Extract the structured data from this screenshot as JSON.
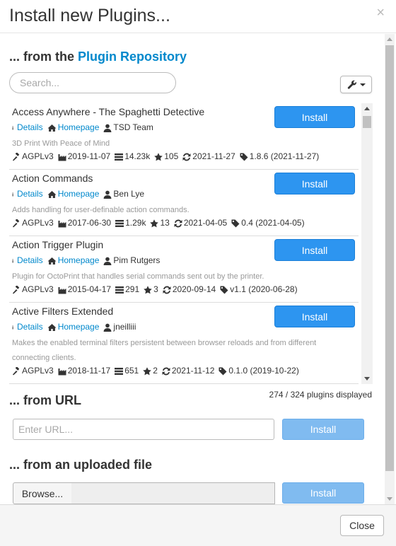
{
  "header": {
    "title": "Install new Plugins...",
    "close_glyph": "×"
  },
  "repository": {
    "prefix": "... from the ",
    "link": "Plugin Repository",
    "search_placeholder": "Search...",
    "tools_icon": "wrench-icon",
    "count_text": "274 / 324 plugins displayed"
  },
  "plugins": [
    {
      "name": "Access Anywhere - The Spaghetti Detective",
      "details_label": "Details",
      "homepage_label": "Homepage",
      "author": "TSD Team",
      "description": "3D Print With Peace of Mind",
      "license": "AGPLv3",
      "created": "2019-11-07",
      "downloads": "14.23k",
      "stars": "105",
      "updated": "2021-11-27",
      "release": "1.8.6 (2021-11-27)",
      "install_label": "Install"
    },
    {
      "name": "Action Commands",
      "details_label": "Details",
      "homepage_label": "Homepage",
      "author": "Ben Lye",
      "description": "Adds handling for user-definable action commands.",
      "license": "AGPLv3",
      "created": "2017-06-30",
      "downloads": "1.29k",
      "stars": "13",
      "updated": "2021-04-05",
      "release": "0.4 (2021-04-05)",
      "install_label": "Install"
    },
    {
      "name": "Action Trigger Plugin",
      "details_label": "Details",
      "homepage_label": "Homepage",
      "author": "Pim Rutgers",
      "description": "Plugin for OctoPrint that handles serial commands sent out by the printer.",
      "license": "AGPLv3",
      "created": "2015-04-17",
      "downloads": "291",
      "stars": "3",
      "updated": "2020-09-14",
      "release": "v1.1 (2020-06-28)",
      "install_label": "Install"
    },
    {
      "name": "Active Filters Extended",
      "details_label": "Details",
      "homepage_label": "Homepage",
      "author": "jneilliii",
      "description": "Makes the enabled terminal filters persistent between browser reloads and from different connecting clients.",
      "license": "AGPLv3",
      "created": "2018-11-17",
      "downloads": "651",
      "stars": "2",
      "updated": "2021-11-12",
      "release": "0.1.0 (2019-10-22)",
      "install_label": "Install"
    }
  ],
  "url_section": {
    "title": "... from URL",
    "placeholder": "Enter URL...",
    "install_label": "Install"
  },
  "file_section": {
    "title": "... from an uploaded file",
    "browse_label": "Browse...",
    "install_label": "Install"
  },
  "footer": {
    "close_label": "Close"
  },
  "colors": {
    "link": "#0088cc",
    "install_button": "#2d95f0",
    "disabled_button": "#80bbf0",
    "description": "#999999"
  }
}
